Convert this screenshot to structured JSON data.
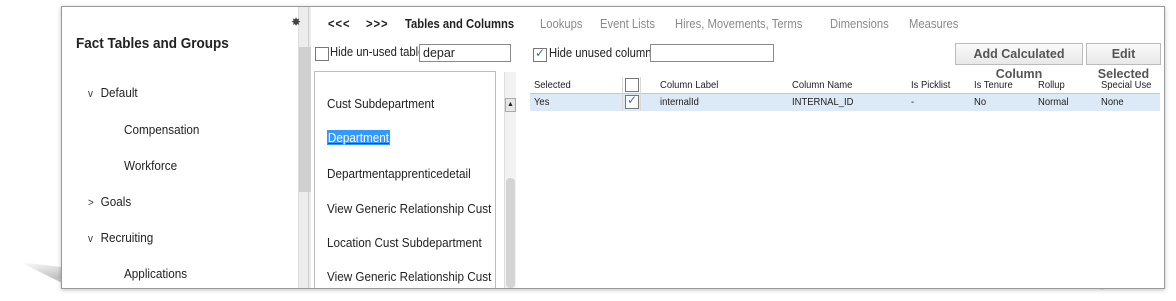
{
  "left_panel": {
    "title": "Fact Tables and Groups",
    "tree": [
      {
        "label": "Default",
        "chevron": "v",
        "level": 0
      },
      {
        "label": "Compensation",
        "chevron": "",
        "level": 1
      },
      {
        "label": "Workforce",
        "chevron": "",
        "level": 1
      },
      {
        "label": "Goals",
        "chevron": ">",
        "level": 0
      },
      {
        "label": "Recruiting",
        "chevron": "v",
        "level": 0
      },
      {
        "label": "Applications",
        "chevron": "",
        "level": 1
      }
    ]
  },
  "nav": {
    "prev": "<<<",
    "next": ">>>",
    "tabs": [
      {
        "label": "Tables and Columns",
        "active": true
      },
      {
        "label": "Lookups",
        "active": false
      },
      {
        "label": "Event Lists",
        "active": false
      },
      {
        "label": "Hires, Movements, Terms",
        "active": false
      },
      {
        "label": "Dimensions",
        "active": false
      },
      {
        "label": "Measures",
        "active": false
      }
    ]
  },
  "controls": {
    "hide_unused_tables_label": "Hide un-used tables",
    "hide_unused_tables_checked": false,
    "table_filter_value": "depar",
    "hide_unused_columns_label": "Hide unused columns",
    "hide_unused_columns_checked": true,
    "column_filter_value": "",
    "add_calculated_column_label": "Add Calculated Column",
    "edit_selected_label": "Edit Selected"
  },
  "tables": [
    {
      "label": "Cust Subdepartment",
      "selected": false
    },
    {
      "label": "Department",
      "selected": true
    },
    {
      "label": "Departmentapprenticedetail",
      "selected": false
    },
    {
      "label": "View Generic Relationship Cust",
      "selected": false
    },
    {
      "label": "Location Cust Subdepartment",
      "selected": false
    },
    {
      "label": "View Generic Relationship Cust",
      "selected": false
    }
  ],
  "columns_grid": {
    "headers": [
      "Selected",
      "",
      "Column Label",
      "Column Name",
      "Is Picklist",
      "Is Tenure",
      "Rollup",
      "Special Use"
    ],
    "rows": [
      {
        "selected": "Yes",
        "checked": true,
        "column_label": "internalId",
        "column_name": "INTERNAL_ID",
        "is_picklist": "-",
        "is_tenure": "No",
        "rollup": "Normal",
        "special_use": "None"
      }
    ]
  },
  "icons": {
    "pin": "pin-icon",
    "scroll_up": "scroll-up-arrow-icon"
  },
  "colors": {
    "selection": "#3399ff",
    "row_highlight": "#dce9f6",
    "tab_inactive": "#8a8a8a"
  }
}
